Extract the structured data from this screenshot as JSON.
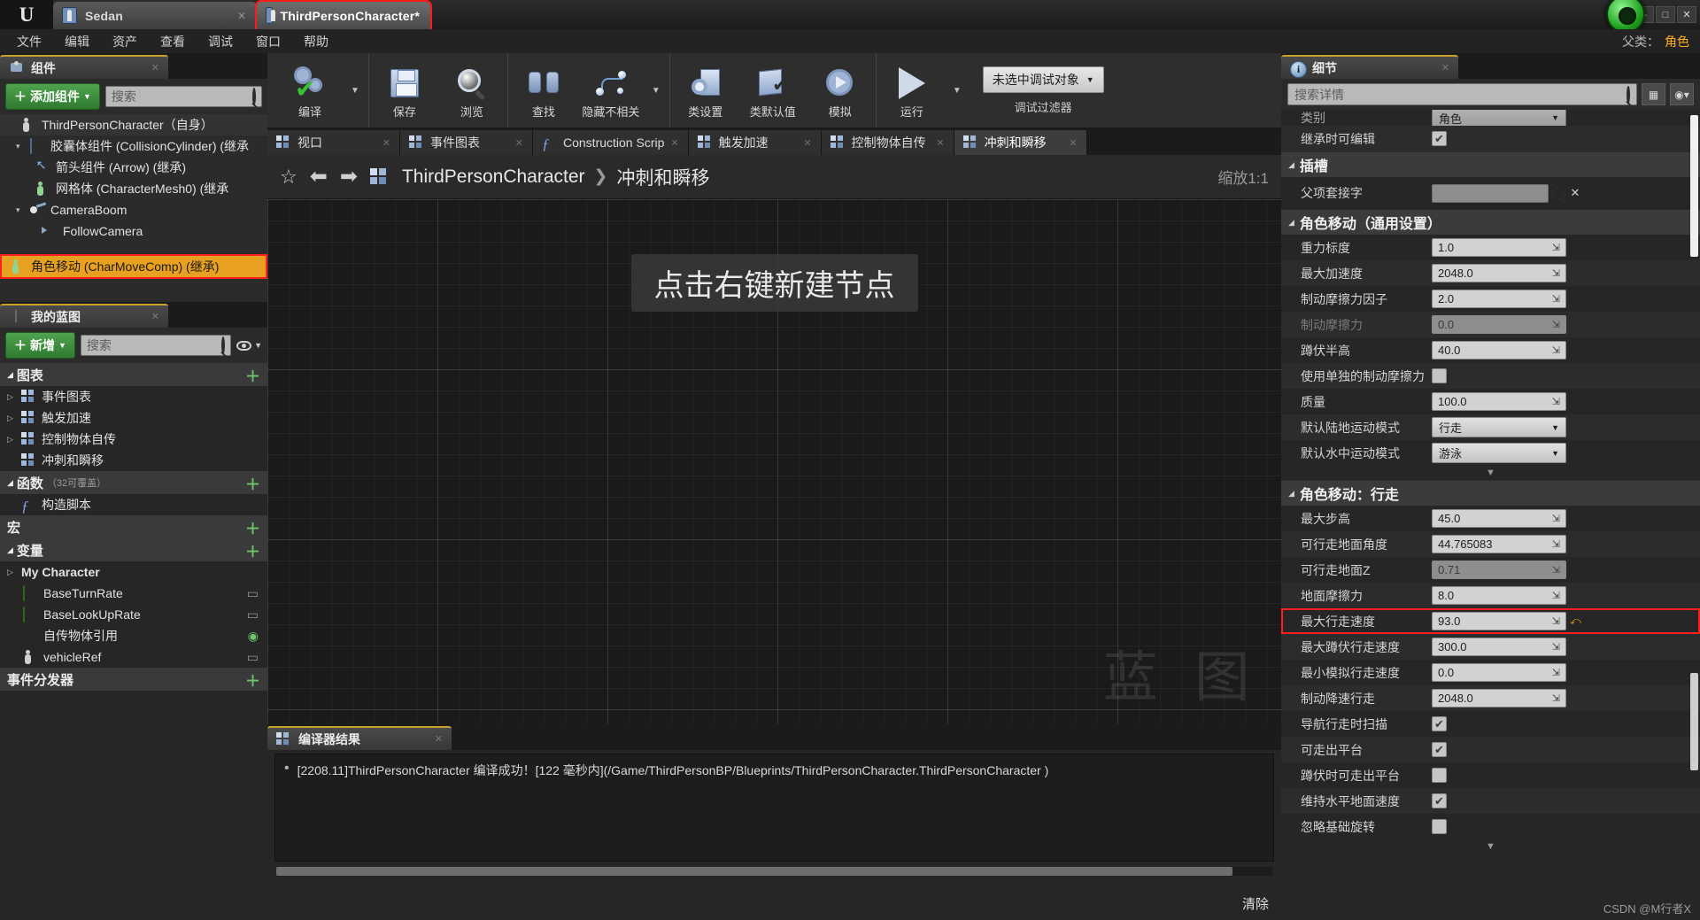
{
  "window": {
    "tabs": [
      {
        "label": "Sedan",
        "active": false
      },
      {
        "label": "ThirdPersonCharacter*",
        "active": true
      }
    ],
    "minimize": "–",
    "maximize": "□",
    "close": "✕"
  },
  "menu": {
    "items": [
      "文件",
      "编辑",
      "资产",
      "查看",
      "调试",
      "窗口",
      "帮助"
    ],
    "parent_class_label": "父类：",
    "parent_class_value": "角色"
  },
  "toolbar": {
    "groups": [
      {
        "items": [
          {
            "label": "编译",
            "icon": "compile-icon",
            "caret": true
          }
        ]
      },
      {
        "items": [
          {
            "label": "保存",
            "icon": "save-icon"
          },
          {
            "label": "浏览",
            "icon": "browse-icon"
          }
        ]
      },
      {
        "items": [
          {
            "label": "查找",
            "icon": "find-icon"
          },
          {
            "label": "隐藏不相关",
            "icon": "hide-unrelated-icon",
            "caret": true
          }
        ]
      },
      {
        "items": [
          {
            "label": "类设置",
            "icon": "class-settings-icon"
          },
          {
            "label": "类默认值",
            "icon": "class-defaults-icon"
          },
          {
            "label": "模拟",
            "icon": "simulate-icon"
          }
        ]
      },
      {
        "items": [
          {
            "label": "运行",
            "icon": "play-icon",
            "caret": true
          }
        ]
      }
    ],
    "debug_object": "未选中调试对象",
    "debug_filter_label": "调试过滤器"
  },
  "components_panel": {
    "tab_title": "组件",
    "add_button": "添加组件",
    "search_placeholder": "搜索",
    "tree": [
      {
        "label": "ThirdPersonCharacter（自身）",
        "depth": 0,
        "icon": "character-icon",
        "arrow": "",
        "selected": false
      },
      {
        "label": "胶囊体组件 (CollisionCylinder) (继承",
        "depth": 1,
        "icon": "capsule-icon",
        "arrow": "▾",
        "selected": false
      },
      {
        "label": "箭头组件 (Arrow) (继承)",
        "depth": 2,
        "icon": "arrow-icon",
        "arrow": "",
        "selected": false
      },
      {
        "label": "网格体 (CharacterMesh0) (继承",
        "depth": 2,
        "icon": "mesh-icon",
        "arrow": "",
        "selected": false
      },
      {
        "label": "CameraBoom",
        "depth": 1,
        "icon": "spring-arm-icon",
        "arrow": "▾",
        "selected": false
      },
      {
        "label": "FollowCamera",
        "depth": 2,
        "icon": "camera-icon",
        "arrow": "",
        "selected": false
      },
      {
        "label": "角色移动 (CharMoveComp) (继承)",
        "depth": 0,
        "icon": "char-move-icon",
        "arrow": "",
        "selected": true,
        "highlight": true
      }
    ]
  },
  "myblueprint_panel": {
    "tab_title": "我的蓝图",
    "add_button": "新增",
    "search_placeholder": "搜索",
    "sections": [
      {
        "title": "图表",
        "plus": true,
        "items": [
          {
            "label": "事件图表",
            "arrow": "▷",
            "icon": "graph-icon"
          },
          {
            "label": "触发加速",
            "arrow": "▷",
            "icon": "graph-icon"
          },
          {
            "label": "控制物体自传",
            "arrow": "▷",
            "icon": "graph-icon"
          },
          {
            "label": "冲刺和瞬移",
            "arrow": "",
            "icon": "graph-icon"
          }
        ]
      },
      {
        "title": "函数",
        "subtitle": "（32可覆盖）",
        "plus": true,
        "items": [
          {
            "label": "构造脚本",
            "arrow": "",
            "icon": "function-icon"
          }
        ]
      },
      {
        "title": "宏",
        "plus": true,
        "items": []
      },
      {
        "title": "变量",
        "plus": true,
        "items": [
          {
            "label": "My Character",
            "arrow": "▷",
            "icon": "",
            "bold": true
          },
          {
            "label": "BaseTurnRate",
            "arrow": "",
            "icon": "float-pill-icon",
            "badge": "edit-icon"
          },
          {
            "label": "BaseLookUpRate",
            "arrow": "",
            "icon": "float-pill-icon",
            "badge": "edit-icon"
          },
          {
            "label": "自传物体引用",
            "arrow": "",
            "icon": "object-ref-icon",
            "badge": "eye-icon"
          },
          {
            "label": "vehicleRef",
            "arrow": "",
            "icon": "actor-ref-icon",
            "badge": "edit-icon"
          }
        ]
      },
      {
        "title": "事件分发器",
        "plus": true,
        "items": []
      }
    ]
  },
  "graph_tabs": [
    {
      "label": "视口",
      "icon": "viewport-icon",
      "active": false,
      "closable": true
    },
    {
      "label": "事件图表",
      "icon": "graph-icon",
      "active": false,
      "closable": true
    },
    {
      "label": "Construction Scrip",
      "icon": "function-icon",
      "active": false,
      "closable": true
    },
    {
      "label": "触发加速",
      "icon": "graph-icon",
      "active": false,
      "closable": true
    },
    {
      "label": "控制物体自传",
      "icon": "graph-icon",
      "active": false,
      "closable": true
    },
    {
      "label": "冲刺和瞬移",
      "icon": "graph-icon",
      "active": true,
      "closable": true
    }
  ],
  "breadcrumb": {
    "root": "ThirdPersonCharacter",
    "separator": "❯",
    "current": "冲刺和瞬移",
    "zoom_label": "缩放1:1"
  },
  "graph_canvas": {
    "hint": "点击右键新建节点",
    "watermark": "蓝 图"
  },
  "compiler_results": {
    "tab_title": "编译器结果",
    "message": "[2208.11]ThirdPersonCharacter 编译成功！[122 毫秒内](/Game/ThirdPersonBP/Blueprints/ThirdPersonCharacter.ThirdPersonCharacter )",
    "clear_label": "清除"
  },
  "details_panel": {
    "tab_title": "细节",
    "search_placeholder": "搜索详情",
    "top_partial_row": {
      "name": "继承时可编辑",
      "checked": true
    },
    "categories": [
      {
        "title": "插槽",
        "rows": [
          {
            "name": "父项套接字",
            "type": "socket",
            "value": ""
          }
        ]
      },
      {
        "title": "角色移动（通用设置）",
        "rows": [
          {
            "name": "重力标度",
            "type": "number",
            "value": "1.0"
          },
          {
            "name": "最大加速度",
            "type": "number",
            "value": "2048.0"
          },
          {
            "name": "制动摩擦力因子",
            "type": "number",
            "value": "2.0"
          },
          {
            "name": "制动摩擦力",
            "type": "number",
            "value": "0.0",
            "disabled": true
          },
          {
            "name": "蹲伏半高",
            "type": "number",
            "value": "40.0"
          },
          {
            "name": "使用单独的制动摩擦力",
            "type": "checkbox",
            "checked": false
          },
          {
            "name": "质量",
            "type": "number",
            "value": "100.0"
          },
          {
            "name": "默认陆地运动模式",
            "type": "select",
            "value": "行走"
          },
          {
            "name": "默认水中运动模式",
            "type": "select",
            "value": "游泳"
          }
        ]
      },
      {
        "title": "角色移动：行走",
        "rows": [
          {
            "name": "最大步高",
            "type": "number",
            "value": "45.0"
          },
          {
            "name": "可行走地面角度",
            "type": "number",
            "value": "44.765083"
          },
          {
            "name": "可行走地面Z",
            "type": "number",
            "value": "0.71",
            "disabled": true
          },
          {
            "name": "地面摩擦力",
            "type": "number",
            "value": "8.0"
          },
          {
            "name": "最大行走速度",
            "type": "number",
            "value": "93.0",
            "highlight": true
          },
          {
            "name": "最大蹲伏行走速度",
            "type": "number",
            "value": "300.0"
          },
          {
            "name": "最小模拟行走速度",
            "type": "number",
            "value": "0.0"
          },
          {
            "name": "制动降速行走",
            "type": "number",
            "value": "2048.0"
          },
          {
            "name": "导航行走时扫描",
            "type": "checkbox",
            "checked": true
          },
          {
            "name": "可走出平台",
            "type": "checkbox",
            "checked": true
          },
          {
            "name": "蹲伏时可走出平台",
            "type": "checkbox",
            "checked": false
          },
          {
            "name": "维持水平地面速度",
            "type": "checkbox",
            "checked": true
          },
          {
            "name": "忽略基础旋转",
            "type": "checkbox",
            "checked": false
          }
        ]
      }
    ],
    "watermark": "CSDN @M行者X"
  }
}
